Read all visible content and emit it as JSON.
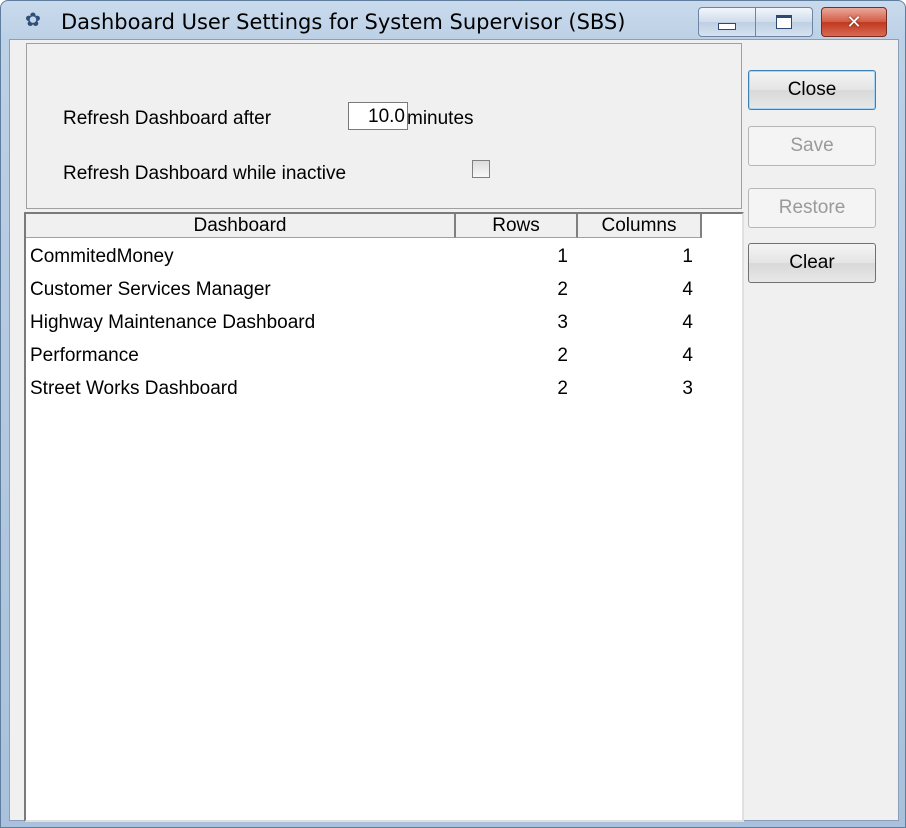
{
  "window": {
    "title": "Dashboard User Settings for System Supervisor (SBS)",
    "icon": "gear-icon",
    "controls": {
      "minimize": "minimize-icon",
      "maximize": "maximize-icon",
      "close": "close-icon",
      "close_glyph": "✕"
    }
  },
  "settings": {
    "refresh_after_label": "Refresh Dashboard after",
    "refresh_minutes_value": "10.0",
    "minutes_label": "minutes",
    "refresh_inactive_label": "Refresh Dashboard while inactive",
    "refresh_inactive_checked": false
  },
  "grid": {
    "headers": [
      "Dashboard",
      "Rows",
      "Columns"
    ],
    "rows": [
      {
        "dashboard": "CommitedMoney",
        "rows": "1",
        "columns": "1"
      },
      {
        "dashboard": "Customer Services Manager",
        "rows": "2",
        "columns": "4"
      },
      {
        "dashboard": "Highway Maintenance Dashboard",
        "rows": "3",
        "columns": "4"
      },
      {
        "dashboard": "Performance",
        "rows": "2",
        "columns": "4"
      },
      {
        "dashboard": "Street Works Dashboard",
        "rows": "2",
        "columns": "3"
      }
    ]
  },
  "buttons": {
    "close": "Close",
    "save": "Save",
    "restore": "Restore",
    "clear": "Clear"
  },
  "colors": {
    "title_close": "#c0391f",
    "disabled_text": "#9a9a9a"
  }
}
